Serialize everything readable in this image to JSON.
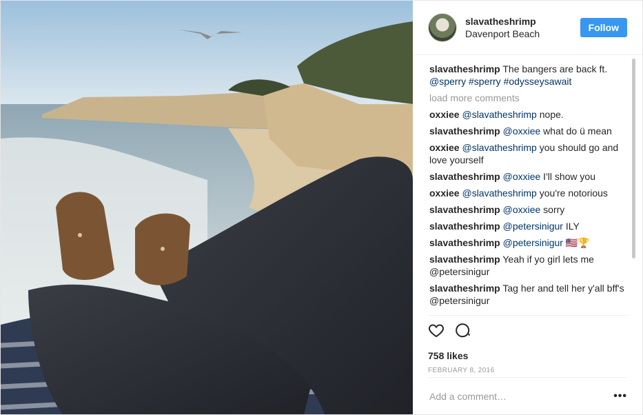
{
  "header": {
    "username": "slavatheshrimp",
    "location": "Davenport Beach",
    "follow_label": "Follow"
  },
  "caption": {
    "username": "slavatheshrimp",
    "text": "The bangers are back ft. ",
    "tags": "@sperry #sperry #odysseysawait"
  },
  "load_more_label": "load more comments",
  "comments": [
    {
      "user": "oxxiee",
      "mention": "@slavatheshrimp",
      "text": " nope."
    },
    {
      "user": "slavatheshrimp",
      "mention": "@oxxiee",
      "text": " what do ü mean"
    },
    {
      "user": "oxxiee",
      "mention": "@slavatheshrimp",
      "text": " you should go and love yourself"
    },
    {
      "user": "slavatheshrimp",
      "mention": "@oxxiee",
      "text": " I'll show you"
    },
    {
      "user": "oxxiee",
      "mention": "@slavatheshrimp",
      "text": " you're notorious"
    },
    {
      "user": "slavatheshrimp",
      "mention": "@oxxiee",
      "text": " sorry"
    },
    {
      "user": "slavatheshrimp",
      "mention": "@petersinigur",
      "text": " ILY"
    },
    {
      "user": "slavatheshrimp",
      "mention": "@petersinigur",
      "text": " 🇺🇸🏆"
    },
    {
      "user": "slavatheshrimp",
      "mention": "",
      "text": " Yeah if yo girl lets me @petersinigur"
    },
    {
      "user": "slavatheshrimp",
      "mention": "",
      "text": " Tag her and tell her y'all bff's @petersinigur"
    }
  ],
  "actions": {
    "likes": "758 likes",
    "date": "FEBRUARY 8, 2016"
  },
  "add_comment": {
    "placeholder": "Add a comment…",
    "more_label": "•••"
  },
  "colors": {
    "accent": "#3897f0",
    "link": "#003569",
    "muted": "#999999"
  },
  "icons": [
    "heart-icon",
    "comment-icon",
    "more-options-icon"
  ]
}
